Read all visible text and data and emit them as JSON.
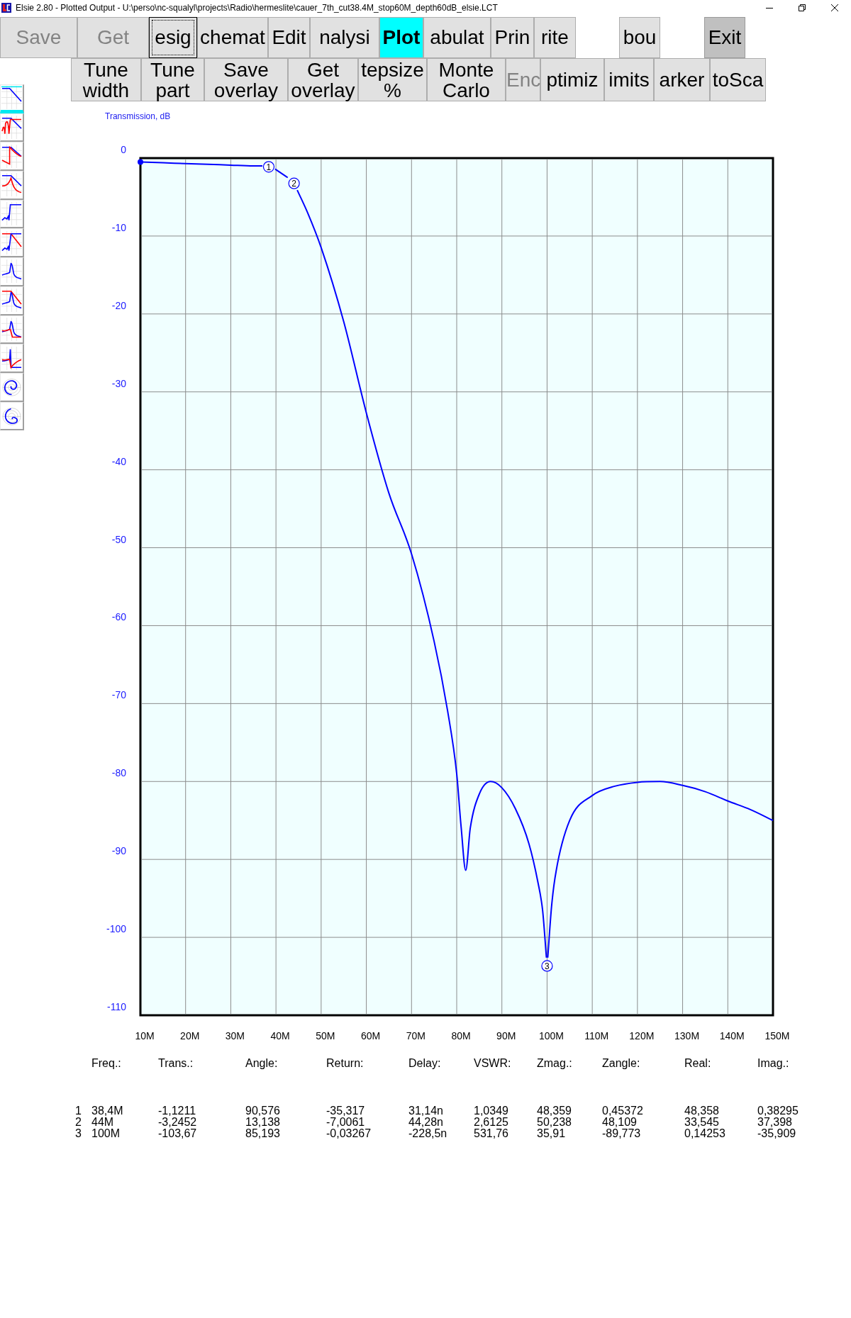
{
  "window": {
    "title": "Elsie 2.80 - Plotted Output - U:\\perso\\nc-squalyl\\projects\\Radio\\hermeslite\\cauer_7th_cut38.4M_stop60M_depth60dB_elsie.LCT"
  },
  "toolbar": [
    {
      "label": "Save",
      "disabled": true,
      "focused": false,
      "selected": false,
      "hovered": false
    },
    {
      "label": "Get",
      "disabled": true,
      "focused": false,
      "selected": false,
      "hovered": false
    },
    {
      "label": "esig",
      "disabled": false,
      "focused": true,
      "selected": false,
      "hovered": false
    },
    {
      "label": "chemat",
      "disabled": false,
      "focused": false,
      "selected": false,
      "hovered": false
    },
    {
      "label": "Edit",
      "disabled": false,
      "focused": false,
      "selected": false,
      "hovered": false
    },
    {
      "label": "nalysi",
      "disabled": false,
      "focused": false,
      "selected": false,
      "hovered": false
    },
    {
      "label": "Plot",
      "disabled": false,
      "focused": false,
      "selected": true,
      "hovered": false
    },
    {
      "label": "abulat",
      "disabled": false,
      "focused": false,
      "selected": false,
      "hovered": false
    },
    {
      "label": "Prin",
      "disabled": false,
      "focused": false,
      "selected": false,
      "hovered": false
    },
    {
      "label": "rite",
      "disabled": false,
      "focused": false,
      "selected": false,
      "hovered": false
    },
    {
      "label": "bou",
      "disabled": false,
      "focused": false,
      "selected": false,
      "hovered": false
    },
    {
      "label": "Exit",
      "disabled": false,
      "focused": false,
      "selected": false,
      "hovered": true
    }
  ],
  "sub_toolbar": [
    {
      "label": "Tune width",
      "disabled": false
    },
    {
      "label": "Tune part",
      "disabled": false
    },
    {
      "label": "Save overlay",
      "disabled": false
    },
    {
      "label": "Get overlay",
      "disabled": false
    },
    {
      "label": "tepsize %",
      "disabled": false
    },
    {
      "label": "Monte Carlo",
      "disabled": false
    },
    {
      "label": "Enc",
      "disabled": true
    },
    {
      "label": "ptimiz",
      "disabled": false
    },
    {
      "label": "imits",
      "disabled": false
    },
    {
      "label": "arker",
      "disabled": false
    },
    {
      "label": "toSca",
      "disabled": false
    }
  ],
  "sidebar": {
    "items": [
      {
        "kind": "graph",
        "selected": true
      },
      {
        "kind": "graph",
        "selected": false
      },
      {
        "kind": "graph",
        "selected": false
      },
      {
        "kind": "graph",
        "selected": false
      },
      {
        "kind": "graph",
        "selected": false
      },
      {
        "kind": "graph",
        "selected": false
      },
      {
        "kind": "graph",
        "selected": false
      },
      {
        "kind": "graph",
        "selected": false
      },
      {
        "kind": "graph",
        "selected": false
      },
      {
        "kind": "graph",
        "selected": false
      },
      {
        "kind": "polar",
        "selected": false
      },
      {
        "kind": "polar",
        "selected": false
      }
    ]
  },
  "plot": {
    "chart_data": {
      "type": "line",
      "ylabel": "Transmission, dB",
      "grid": true,
      "x": [
        10,
        15,
        20,
        25,
        30,
        35,
        37,
        38.4,
        39.8,
        42.6,
        44,
        44.7,
        47,
        50,
        55,
        60,
        65,
        70,
        75,
        78,
        80,
        81,
        82,
        83,
        85,
        87.5,
        90,
        93,
        96,
        98,
        99,
        99.85,
        100,
        100.15,
        101,
        102,
        105,
        110,
        115,
        120,
        125,
        130,
        135,
        140,
        145,
        150
      ],
      "series": [
        {
          "color": "#0000ff",
          "values": [
            -0.5,
            -0.6,
            -0.7,
            -0.8,
            -0.9,
            -1.0,
            -1.0,
            null,
            -1.4,
            -2.5,
            null,
            -4.1,
            -7,
            -11.5,
            -21,
            -32.7,
            -43,
            -50.8,
            -62,
            -71,
            -79,
            -86,
            -91.4,
            -86,
            -81.6,
            -80,
            -80.8,
            -83.5,
            -88,
            -93,
            -96.5,
            -102.6,
            null,
            -102.6,
            -96,
            -91.5,
            -85,
            -81.8,
            -80.6,
            -80.1,
            -80,
            -80.5,
            -81.3,
            -82.5,
            -83.6,
            -85
          ]
        }
      ],
      "xlim": [
        10,
        150
      ],
      "ylim": [
        -110,
        0
      ],
      "xticks": [
        {
          "value": 10,
          "label": "10M"
        },
        {
          "value": 20,
          "label": "20M"
        },
        {
          "value": 30,
          "label": "30M"
        },
        {
          "value": 40,
          "label": "40M"
        },
        {
          "value": 50,
          "label": "50M"
        },
        {
          "value": 60,
          "label": "60M"
        },
        {
          "value": 70,
          "label": "70M"
        },
        {
          "value": 80,
          "label": "80M"
        },
        {
          "value": 90,
          "label": "90M"
        },
        {
          "value": 100,
          "label": "100M"
        },
        {
          "value": 110,
          "label": "110M"
        },
        {
          "value": 120,
          "label": "120M"
        },
        {
          "value": 130,
          "label": "130M"
        },
        {
          "value": 140,
          "label": "140M"
        },
        {
          "value": 150,
          "label": "150M"
        }
      ],
      "yticks": [
        0,
        -10,
        -20,
        -30,
        -40,
        -50,
        -60,
        -70,
        -80,
        -90,
        -100,
        -110
      ],
      "annotations": [
        {
          "x": 38.4,
          "y": -1.1211,
          "text": "1"
        },
        {
          "x": 44,
          "y": -3.2452,
          "text": "2"
        },
        {
          "x": 100,
          "y": -103.67,
          "text": "3"
        }
      ]
    }
  },
  "readout": {
    "columns": [
      "Freq.:",
      "Trans.:",
      "Angle:",
      "Return:",
      "Delay:",
      "VSWR:",
      "Zmag.:",
      "Zangle:",
      "Real:",
      "Imag.:"
    ],
    "rows": [
      {
        "index": "1",
        "cells": [
          "38,4M",
          "-1,1211",
          "90,576",
          "-35,317",
          "31,14n",
          "1,0349",
          "48,359",
          "0,45372",
          "48,358",
          "0,38295"
        ]
      },
      {
        "index": "2",
        "cells": [
          "44M",
          "-3,2452",
          "13,138",
          "-7,0061",
          "44,28n",
          "2,6125",
          "50,238",
          "48,109",
          "33,545",
          "37,398"
        ]
      },
      {
        "index": "3",
        "cells": [
          "100M",
          "-103,67",
          "85,193",
          "-0,03267",
          "-228,5n",
          "531,76",
          "35,91",
          "-89,773",
          "0,14253",
          "-35,909"
        ]
      }
    ]
  }
}
